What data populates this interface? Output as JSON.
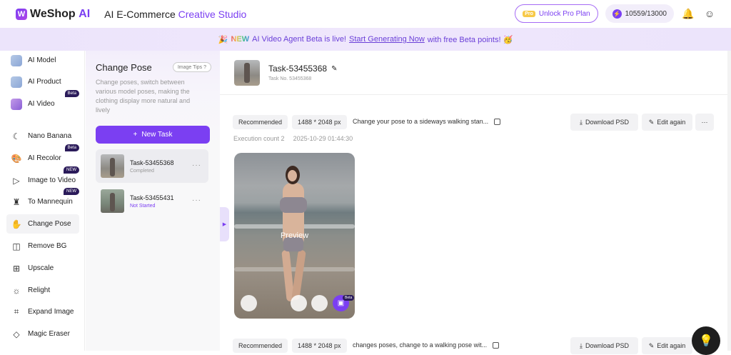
{
  "app": {
    "brand": "WeShop",
    "brand_ai": "AI",
    "studio_prefix": "AI E-Commerce ",
    "studio_accent": "Creative Studio",
    "accent_color": "#7b3ff2"
  },
  "top": {
    "pro_badge": "Pro",
    "unlock_label": "Unlock Pro Plan",
    "credits": "10559/13000"
  },
  "banner": {
    "prefix": "🎉 ",
    "new_tag": "NEW",
    "text": " AI Video Agent Beta is live! ",
    "link": "Start Generating Now",
    "suffix": " with free Beta points! 🥳"
  },
  "sidebar": {
    "items": [
      {
        "label": "AI Model",
        "icon": "ai-model-icon"
      },
      {
        "label": "AI Product",
        "icon": "ai-product-icon"
      },
      {
        "label": "AI Video",
        "icon": "ai-video-icon",
        "tag": "Beta"
      },
      {
        "label": "Nano Banana",
        "icon": "banana-icon"
      },
      {
        "label": "AI Recolor",
        "icon": "palette-icon",
        "tag": "Beta"
      },
      {
        "label": "Image to Video",
        "icon": "video-icon",
        "tag": "NEW"
      },
      {
        "label": "To Mannequin",
        "icon": "mannequin-icon",
        "tag": "NEW"
      },
      {
        "label": "Change Pose",
        "icon": "pose-icon",
        "active": true
      },
      {
        "label": "Remove BG",
        "icon": "remove-bg-icon"
      },
      {
        "label": "Upscale",
        "icon": "upscale-icon"
      },
      {
        "label": "Relight",
        "icon": "relight-icon"
      },
      {
        "label": "Expand Image",
        "icon": "expand-icon"
      },
      {
        "label": "Magic Eraser",
        "icon": "eraser-icon"
      }
    ]
  },
  "panel": {
    "title": "Change Pose",
    "tips": "Image Tips",
    "description": "Change poses, switch between various model poses, making the clothing display more natural and lively",
    "new_task": "New Task",
    "tasks": [
      {
        "name": "Task-53455368",
        "status": "Completed"
      },
      {
        "name": "Task-53455431",
        "status": "Not Started"
      }
    ]
  },
  "main": {
    "title": "Task-53455368",
    "task_no": "Task No. 53455368",
    "results": [
      {
        "tag": "Recommended",
        "size": "1488 * 2048 px",
        "prompt": "Change your pose to a sideways walking stan...",
        "download": "Download PSD",
        "edit": "Edit again",
        "execution": "Execution count 2",
        "time": "2025-10-29 01:44:30",
        "preview": "Preview",
        "beta": "Beta"
      },
      {
        "tag": "Recommended",
        "size": "1488 * 2048 px",
        "prompt": "changes poses, change to a walking pose wit...",
        "download": "Download PSD",
        "edit": "Edit again"
      }
    ]
  }
}
